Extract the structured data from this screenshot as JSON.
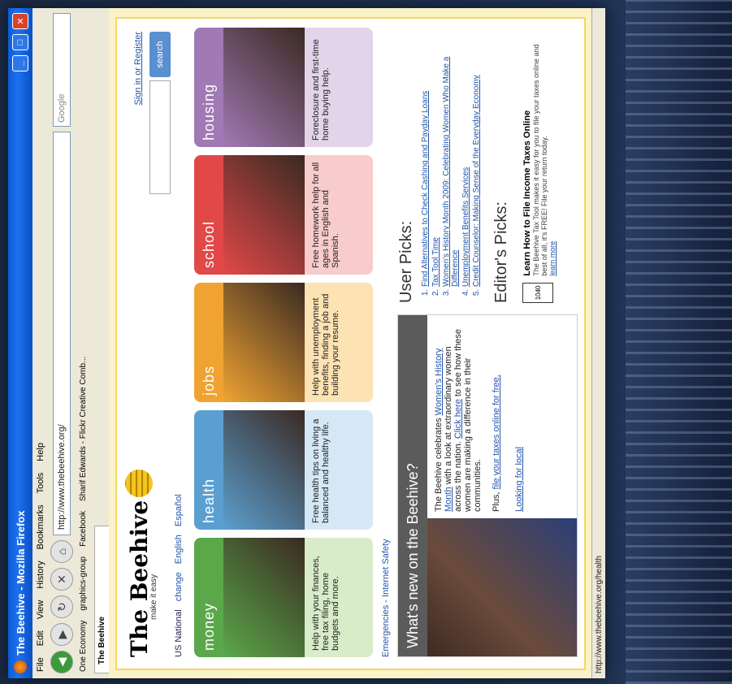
{
  "window": {
    "title": "The Beehive - Mozilla Firefox"
  },
  "menu": [
    "File",
    "Edit",
    "View",
    "History",
    "Bookmarks",
    "Tools",
    "Help"
  ],
  "nav": {
    "url": "http://www.thebeehive.org/",
    "search_placeholder": "Google"
  },
  "bookmarks": [
    "One Economy",
    "graphics-group",
    "Facebook",
    "Sharif Edwards - Flickr Creative Comb..."
  ],
  "tab": {
    "title": "The Beehive"
  },
  "status": {
    "text": "http://www.thebeehive.org/health"
  },
  "site": {
    "logo": "The Beehive",
    "tagline": "make it easy",
    "top_links": {
      "national": "US National",
      "national_change": "change",
      "english": "English",
      "espanol": "Español"
    },
    "sign_in": "Sign in or Register",
    "search_button": "search",
    "quick_links": {
      "emergencies": "Emergencies",
      "sep": "-",
      "internet_safety": "Internet Safety"
    }
  },
  "cards": [
    {
      "title": "money",
      "color": "#5aa84a",
      "light": "#d8ecc9",
      "desc": "Help with your finances, free tax filing, home budgets and more."
    },
    {
      "title": "health",
      "color": "#5b9fd0",
      "light": "#d5e8f5",
      "desc": "Free health tips on living a balanced and healthy life."
    },
    {
      "title": "jobs",
      "color": "#f0a332",
      "light": "#fde2b3",
      "desc": "Help with unemployment benefits, finding a job and building your resume."
    },
    {
      "title": "school",
      "color": "#e24848",
      "light": "#f8cccc",
      "desc": "Free homework help for all ages in English and Spanish."
    },
    {
      "title": "housing",
      "color": "#a179b4",
      "light": "#e3d4ea",
      "desc": "Foreclosure and first-time home buying help."
    }
  ],
  "news": {
    "title": "What's new on the Beehive?",
    "p1_a": "The Beehive celebrates",
    "p1_link": "Women's History Month",
    "p1_b": "with a look at extraordinary women across the nation.",
    "p1_link2": "Click here",
    "p1_c": "to see how these women are making a difference in their communities.",
    "p2_a": "Plus,",
    "p2_link": "file your taxes online for free.",
    "local": "Looking for local"
  },
  "user_picks": {
    "title": "User Picks:",
    "items": [
      "Find Alternatives to Check Cashing and Payday Loans",
      "Tax Tool Time",
      "Women's History Month 2009: Celebrating Women Who Make a Difference",
      "Unemployment Benefits Services",
      "Credit Counselor: Making Sense of the Everyday Economy"
    ]
  },
  "editors_picks": {
    "title": "Editor's Picks:",
    "item_title": "Learn How to File Income Taxes Online",
    "item_text": "The Beehive Tax Tool makes it easy for you to file your taxes online and best of all, it's FREE! File your return today.",
    "more": "learn more"
  }
}
